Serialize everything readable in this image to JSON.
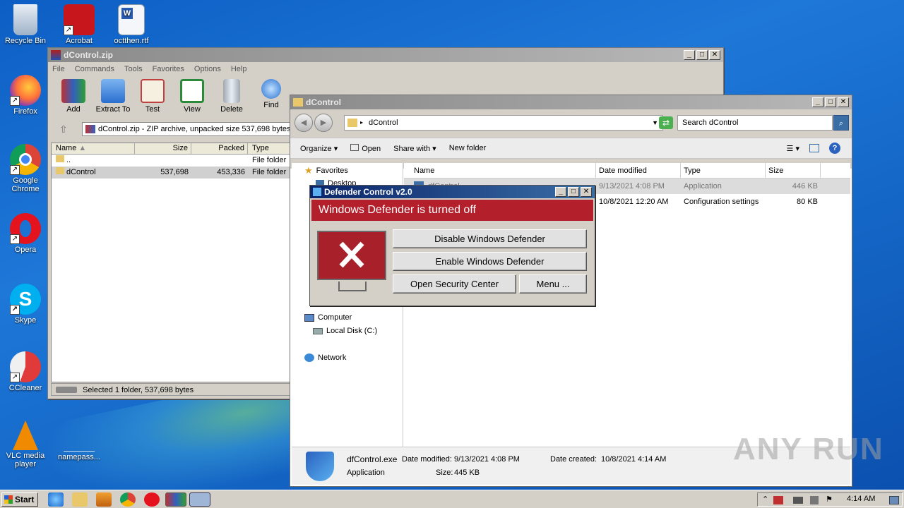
{
  "desktop": {
    "icons": [
      {
        "label": "Recycle Bin"
      },
      {
        "label": "Acrobat"
      },
      {
        "label": "octthen.rtf"
      },
      {
        "label": "Firefox"
      },
      {
        "label": "Google Chrome"
      },
      {
        "label": "Opera"
      },
      {
        "label": "Skype"
      },
      {
        "label": "CCleaner"
      },
      {
        "label": "VLC media player"
      },
      {
        "label": "namepass..."
      }
    ]
  },
  "winrar": {
    "title": "dControl.zip",
    "menu": [
      "File",
      "Commands",
      "Tools",
      "Favorites",
      "Options",
      "Help"
    ],
    "tools": [
      "Add",
      "Extract To",
      "Test",
      "View",
      "Delete",
      "Find"
    ],
    "path": "dControl.zip - ZIP archive, unpacked size 537,698 bytes",
    "columns": [
      "Name",
      "Size",
      "Packed",
      "Type"
    ],
    "rows": [
      {
        "name": "..",
        "size": "",
        "packed": "",
        "type": "File folder"
      },
      {
        "name": "dControl",
        "size": "537,698",
        "packed": "453,336",
        "type": "File folder"
      }
    ],
    "status": "Selected 1 folder, 537,698 bytes"
  },
  "explorer": {
    "title": "dControl",
    "address": "dControl",
    "search_placeholder": "Search dControl",
    "commands": [
      "Organize",
      "Open",
      "Share with",
      "New folder"
    ],
    "nav": {
      "favorites": "Favorites",
      "desktop": "Desktop",
      "computer": "Computer",
      "local_disk": "Local Disk (C:)",
      "network": "Network"
    },
    "columns": [
      "Name",
      "Date modified",
      "Type",
      "Size"
    ],
    "rows": [
      {
        "name": "dfControl",
        "date": "9/13/2021 4:08 PM",
        "type": "Application",
        "size": "446 KB"
      },
      {
        "name": "",
        "date": "10/8/2021 12:20 AM",
        "type": "Configuration settings",
        "size": "80 KB"
      }
    ],
    "details": {
      "filename": "dfControl.exe",
      "kind": "Application",
      "modified_label": "Date modified:",
      "modified": "9/13/2021 4:08 PM",
      "size_label": "Size:",
      "size": "445 KB",
      "created_label": "Date created:",
      "created": "10/8/2021 4:14 AM"
    }
  },
  "defender": {
    "title": "Defender Control v2.0",
    "status": "Windows Defender is turned off",
    "buttons": {
      "disable": "Disable Windows Defender",
      "enable": "Enable Windows Defender",
      "security": "Open Security Center",
      "menu": "Menu ..."
    },
    "status_color": "#b3202c"
  },
  "taskbar": {
    "start": "Start",
    "clock": "4:14 AM"
  },
  "watermark": "ANY RUN"
}
